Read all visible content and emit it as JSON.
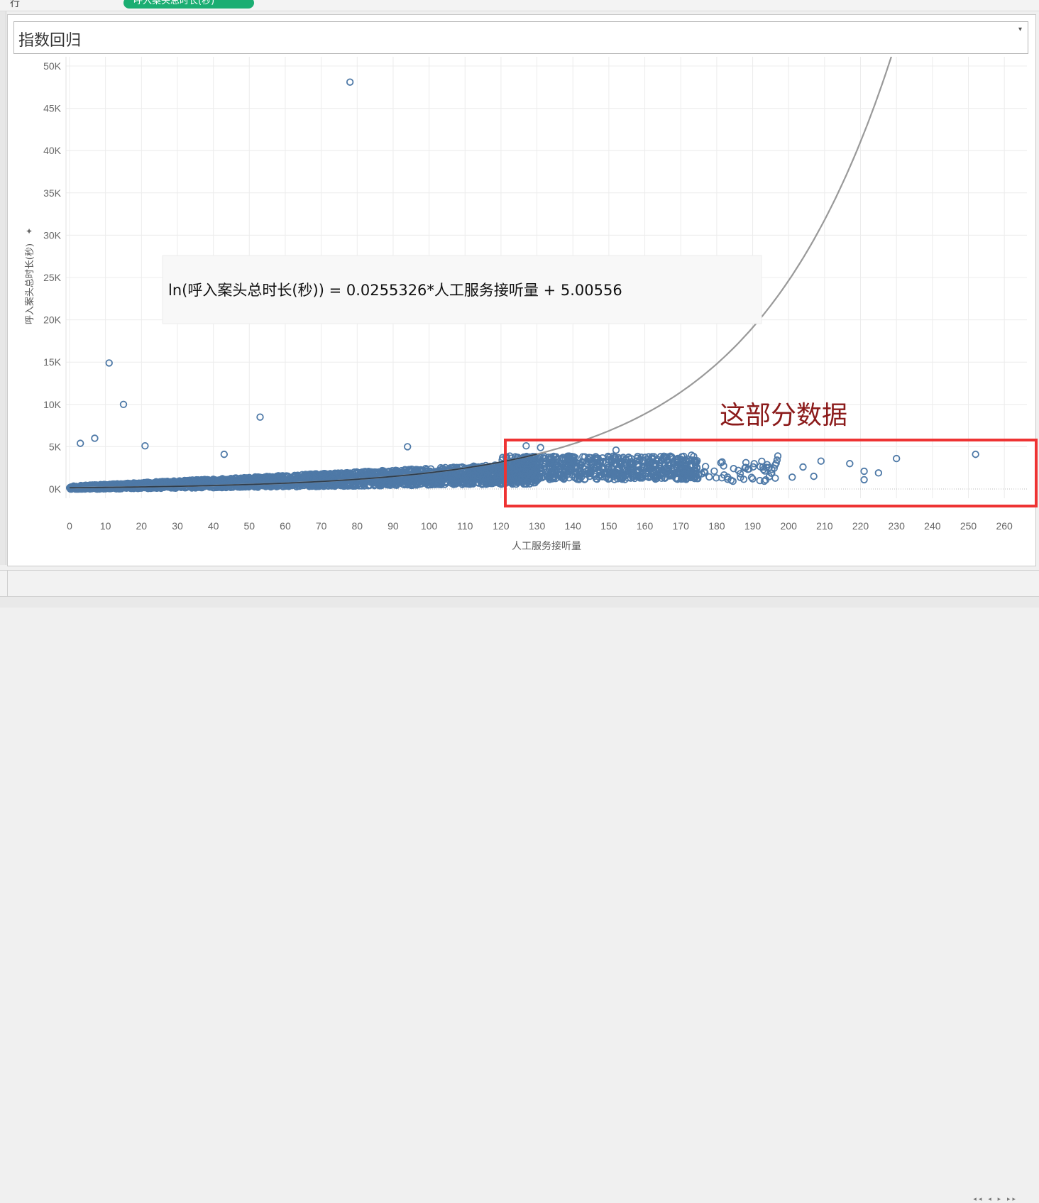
{
  "toolbar": {
    "rows_label": "行",
    "rows_pill": "呼入案头总时长(秒)"
  },
  "parameter": {
    "selected": "指数回归"
  },
  "annotation": {
    "equation": "ln(呼入案头总时长(秒)) = 0.0255326*人工服务接听量 + 5.00556",
    "highlight_label": "这部分数据"
  },
  "colors": {
    "marks": "#4e79a7",
    "trend": "#999999",
    "highlight": "#ee3333",
    "highlight_text": "#8b1a1a"
  },
  "icons": {
    "caret": "dropdown-caret-icon",
    "pin": "pin-icon"
  },
  "chart_data": {
    "type": "scatter",
    "xlabel": "人工服务接听量",
    "ylabel": "呼入案头总时长(秒)",
    "xlim": [
      0,
      265
    ],
    "ylim": [
      0,
      50000
    ],
    "x_ticks": [
      0,
      10,
      20,
      30,
      40,
      50,
      60,
      70,
      80,
      90,
      100,
      110,
      120,
      130,
      140,
      150,
      160,
      170,
      180,
      190,
      200,
      210,
      220,
      230,
      240,
      250,
      260
    ],
    "y_ticks": [
      0,
      5000,
      10000,
      15000,
      20000,
      25000,
      30000,
      35000,
      40000,
      45000,
      50000
    ],
    "y_tick_labels": [
      "0K",
      "5K",
      "10K",
      "15K",
      "20K",
      "25K",
      "30K",
      "35K",
      "40K",
      "45K",
      "50K"
    ],
    "grid": true,
    "trend": {
      "type": "exponential",
      "a": 0.0255326,
      "b": 5.00556
    },
    "outliers": [
      {
        "x": 78,
        "y": 48100
      },
      {
        "x": 11,
        "y": 14900
      },
      {
        "x": 15,
        "y": 10000
      },
      {
        "x": 53,
        "y": 8500
      },
      {
        "x": 7,
        "y": 6000
      },
      {
        "x": 21,
        "y": 5100
      },
      {
        "x": 3,
        "y": 5400
      },
      {
        "x": 94,
        "y": 5000
      },
      {
        "x": 43,
        "y": 4100
      },
      {
        "x": 127,
        "y": 5100
      },
      {
        "x": 131,
        "y": 4900
      },
      {
        "x": 152,
        "y": 4600
      },
      {
        "x": 173,
        "y": 4000
      },
      {
        "x": 197,
        "y": 3900
      },
      {
        "x": 209,
        "y": 3300
      },
      {
        "x": 217,
        "y": 3000
      },
      {
        "x": 221,
        "y": 2100
      },
      {
        "x": 221,
        "y": 1100
      },
      {
        "x": 225,
        "y": 1900
      },
      {
        "x": 230,
        "y": 3600
      },
      {
        "x": 252,
        "y": 4100
      },
      {
        "x": 204,
        "y": 2600
      },
      {
        "x": 207,
        "y": 1500
      },
      {
        "x": 201,
        "y": 1400
      },
      {
        "x": 193,
        "y": 2300
      },
      {
        "x": 190,
        "y": 1200
      },
      {
        "x": 192,
        "y": 1000
      },
      {
        "x": 186,
        "y": 2200
      }
    ]
  }
}
